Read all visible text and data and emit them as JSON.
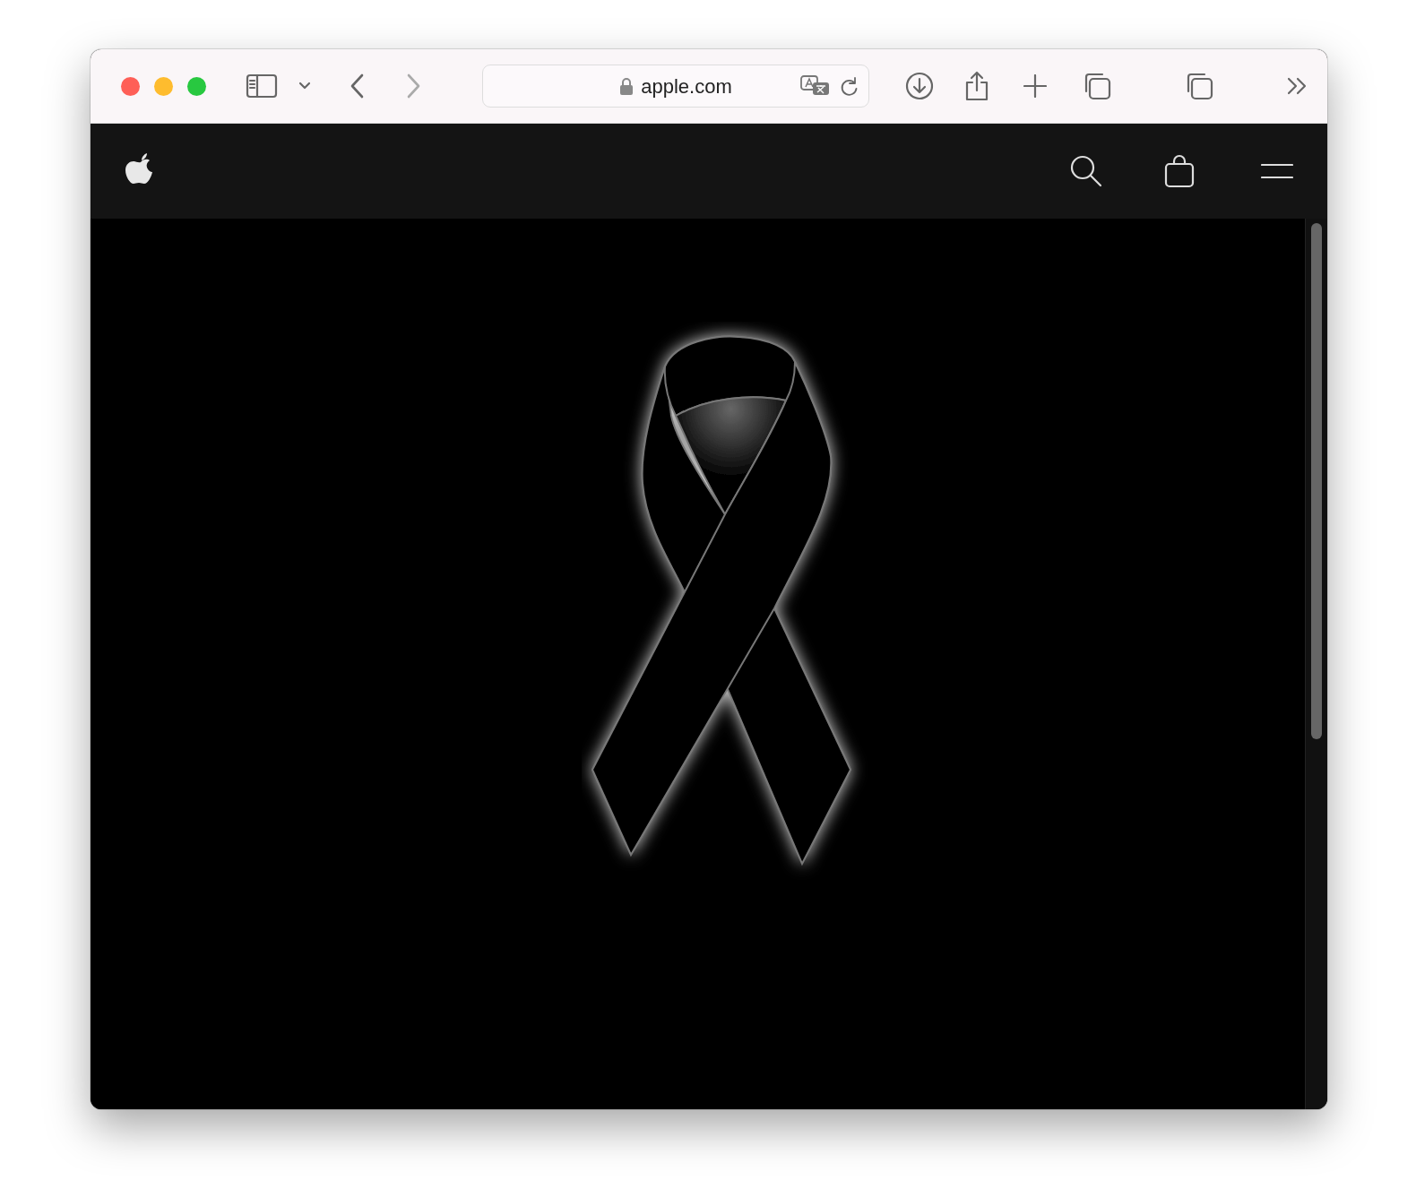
{
  "toolbar": {
    "url": "apple.com",
    "back_disabled": false,
    "forward_disabled": true
  }
}
